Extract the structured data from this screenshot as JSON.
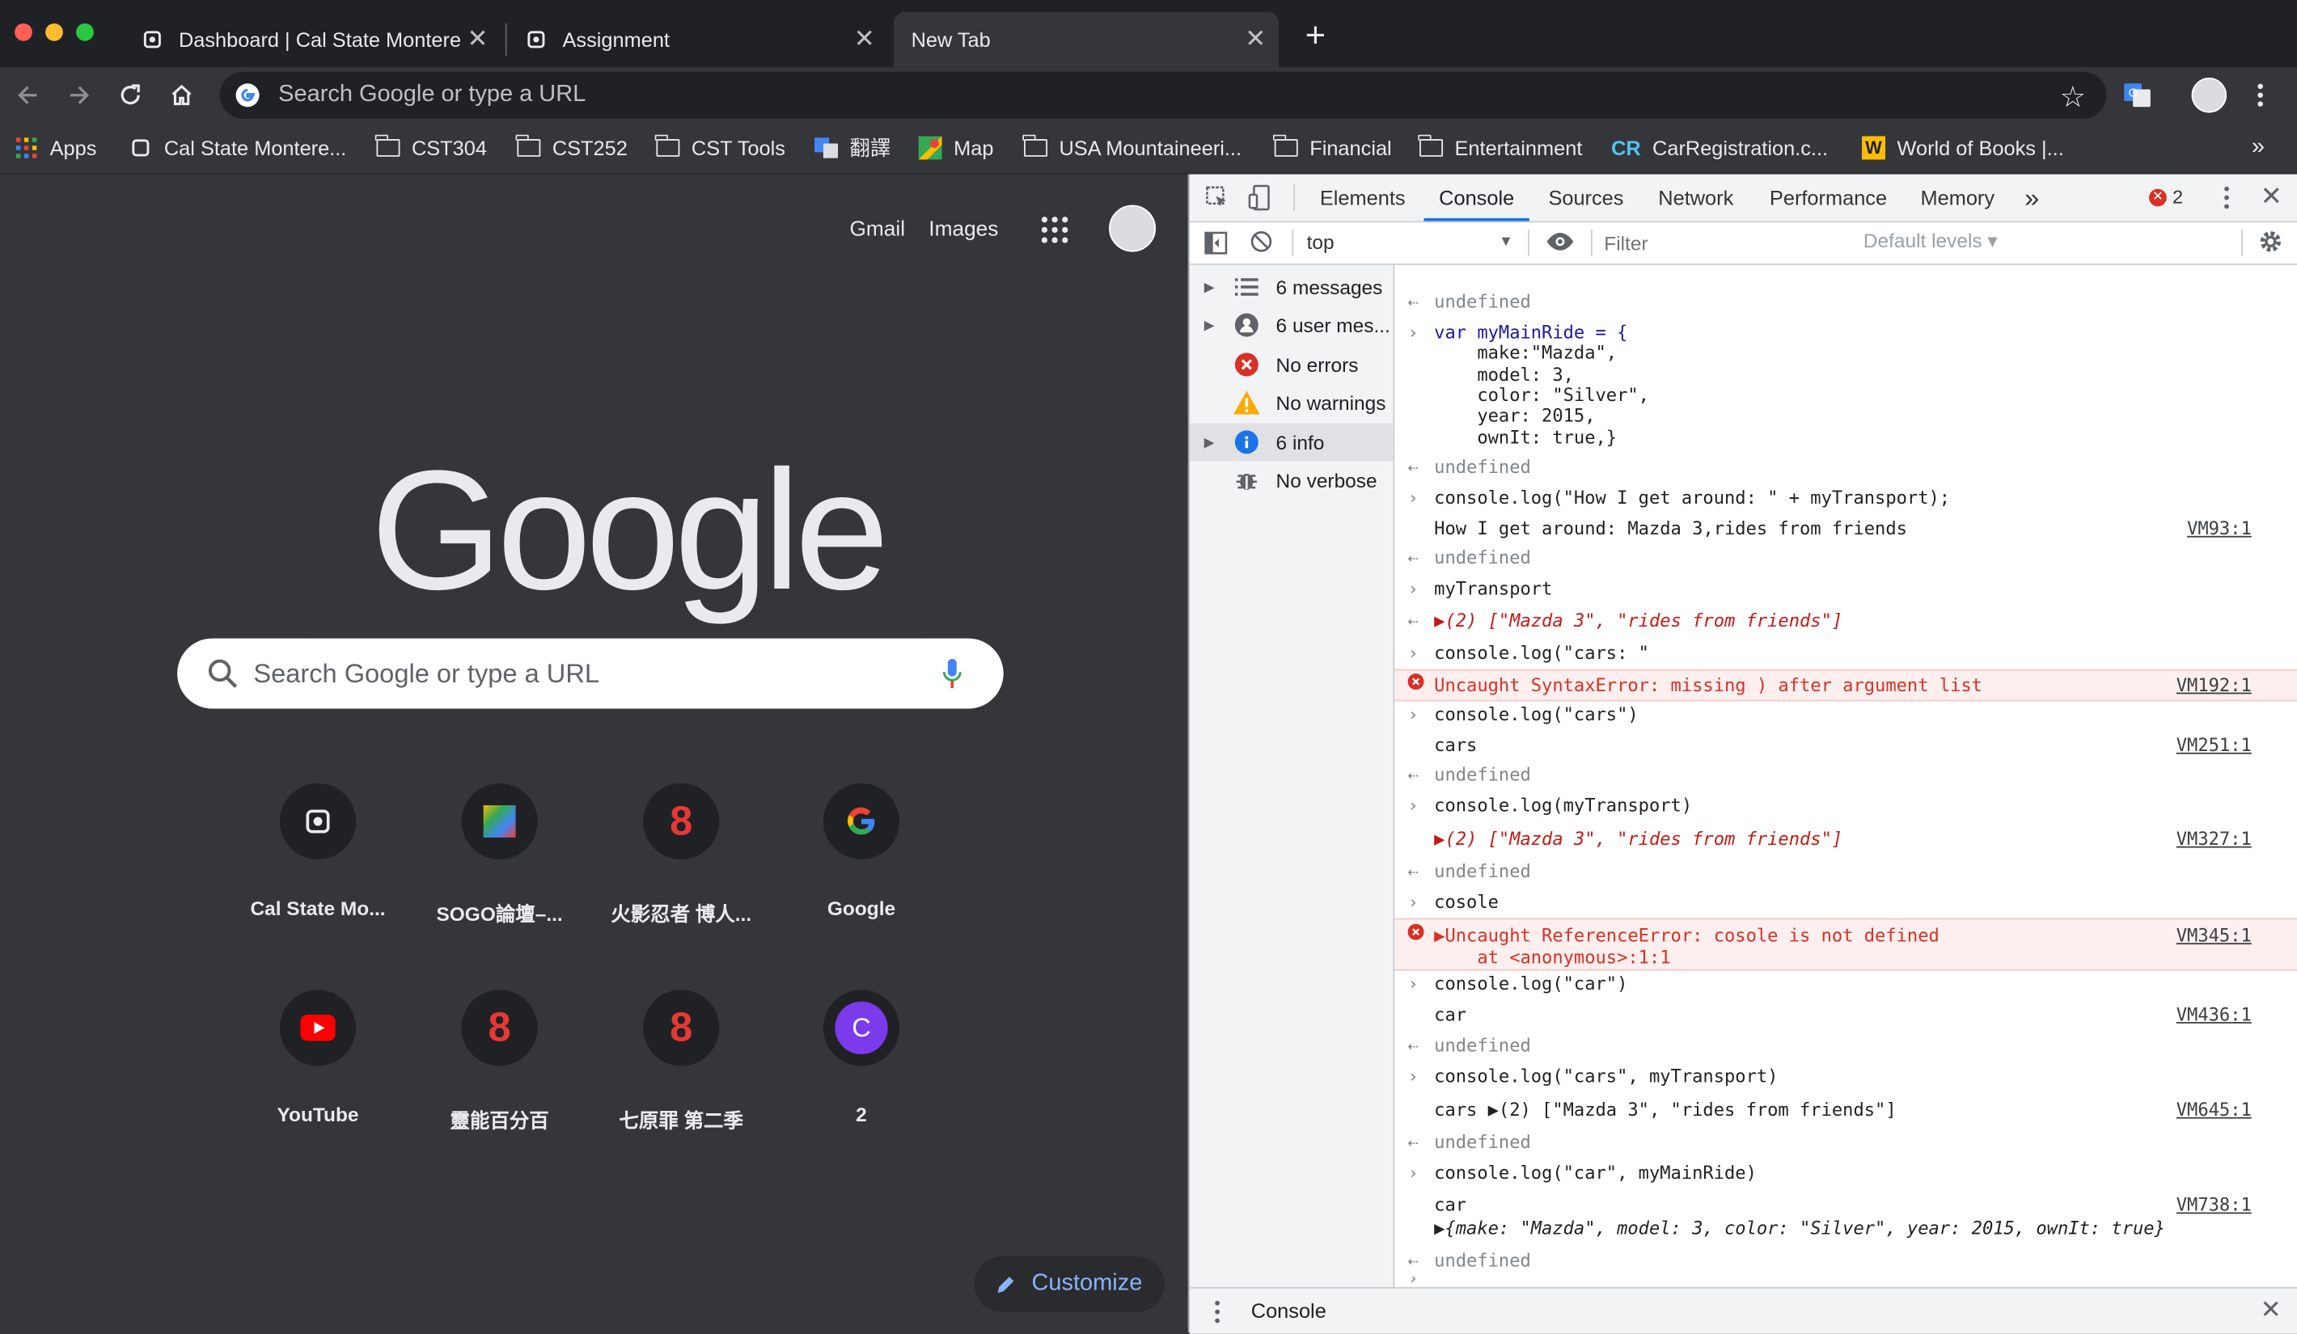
{
  "browser": {
    "tabs": [
      {
        "title": "Dashboard | Cal State Montere",
        "close": "✕"
      },
      {
        "title": "Assignment",
        "close": "✕"
      },
      {
        "title": "New Tab",
        "close": "✕"
      }
    ],
    "new_tab": "+",
    "omnibox_placeholder": "Search Google or type a URL",
    "bookmarks": [
      "Apps",
      "Cal State Montere...",
      "CST304",
      "CST252",
      "CST Tools",
      "翻譯",
      "Map",
      "USA Mountaineeri...",
      "Financial",
      "Entertainment",
      "CarRegistration.c...",
      "World of Books |..."
    ],
    "bookmarks_more": "»"
  },
  "ntp": {
    "links": {
      "gmail": "Gmail",
      "images": "Images"
    },
    "logo": "Google",
    "search_placeholder": "Search Google or type a URL",
    "shortcuts": [
      {
        "label": "Cal State Mo..."
      },
      {
        "label": "SOGO論壇–..."
      },
      {
        "label": "火影忍者 博人..."
      },
      {
        "label": "Google"
      },
      {
        "label": "YouTube"
      },
      {
        "label": "靈能百分百"
      },
      {
        "label": "七原罪 第二季"
      },
      {
        "label": "2",
        "letter": "C"
      }
    ],
    "shortcut_glyph_eight": "8",
    "customize": "Customize"
  },
  "devtools": {
    "tabs": [
      "Elements",
      "Console",
      "Sources",
      "Network",
      "Performance",
      "Memory"
    ],
    "more_tabs": "»",
    "error_count": "2",
    "context": "top",
    "filter_placeholder": "Filter",
    "levels": "Default levels ▾",
    "sidebar": [
      "6 messages",
      "6 user mes...",
      "No errors",
      "No warnings",
      "6 info",
      "No verbose"
    ],
    "console_lines": [
      {
        "text": "undefined"
      },
      {
        "text": "var myMainRide = {"
      },
      {
        "text": "    make:\"Mazda\","
      },
      {
        "text": "    model: 3,"
      },
      {
        "text": "    color: \"Silver\","
      },
      {
        "text": "    year: 2015,"
      },
      {
        "text": "    ownIt: true,}"
      },
      {
        "text": "undefined"
      },
      {
        "text": "console.log(\"How I get around: \" + myTransport);"
      },
      {
        "text": "How I get around: Mazda 3,rides from friends",
        "src": "VM93:1"
      },
      {
        "text": "undefined"
      },
      {
        "text": "myTransport"
      },
      {
        "text": "▶(2) [\"Mazda 3\", \"rides from friends\"]"
      },
      {
        "text": "console.log(\"cars: \""
      },
      {
        "text": "Uncaught SyntaxError: missing ) after argument list",
        "src": "VM192:1"
      },
      {
        "text": "console.log(\"cars\")"
      },
      {
        "text": "cars",
        "src": "VM251:1"
      },
      {
        "text": "undefined"
      },
      {
        "text": "console.log(myTransport)"
      },
      {
        "text": "▶(2) [\"Mazda 3\", \"rides from friends\"]",
        "src": "VM327:1"
      },
      {
        "text": "undefined"
      },
      {
        "text": "cosole"
      },
      {
        "text": "▶Uncaught ReferenceError: cosole is not defined"
      },
      {
        "text": "    at <anonymous>:1:1",
        "src": "VM345:1"
      },
      {
        "text": "console.log(\"car\")"
      },
      {
        "text": "car",
        "src": "VM436:1"
      },
      {
        "text": "undefined"
      },
      {
        "text": "console.log(\"cars\", myTransport)"
      },
      {
        "text": "cars ▶(2) [\"Mazda 3\", \"rides from friends\"]",
        "src": "VM645:1"
      },
      {
        "text": "undefined"
      },
      {
        "text": "console.log(\"car\", myMainRide)"
      },
      {
        "text": "car",
        "src": "VM738:1"
      },
      {
        "text": "▶{make: \"Mazda\", model: 3, color: \"Silver\", year: 2015, ownIt: true}"
      },
      {
        "text": "undefined"
      }
    ],
    "drawer_tab": "Console"
  },
  "colors": {
    "chrome_dark": "#202124",
    "ntp_bg": "#35363a",
    "accent": "#8ab4f8",
    "error": "#d93025"
  }
}
